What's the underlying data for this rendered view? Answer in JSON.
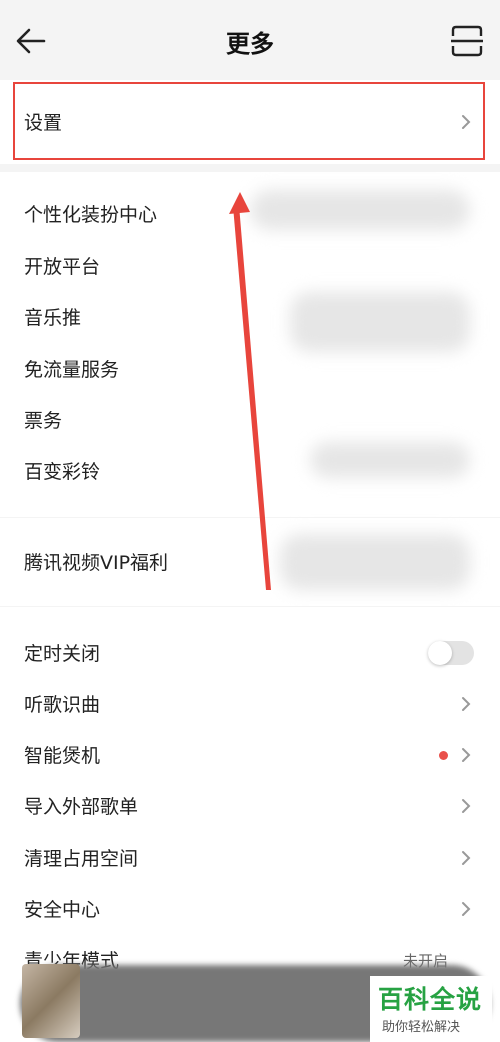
{
  "header": {
    "title": "更多",
    "back_icon": "arrow-left-icon",
    "scan_icon": "scan-icon"
  },
  "settings": {
    "label": "设置"
  },
  "group1": [
    {
      "label": "个性化装扮中心"
    },
    {
      "label": "开放平台"
    },
    {
      "label": "音乐推"
    },
    {
      "label": "免流量服务"
    },
    {
      "label": "票务"
    },
    {
      "label": "百变彩铃"
    }
  ],
  "group2": {
    "label": "腾讯视频VIP福利"
  },
  "group3": [
    {
      "label": "定时关闭",
      "control": "toggle",
      "toggle_on": false
    },
    {
      "label": "听歌识曲",
      "control": "chevron"
    },
    {
      "label": "智能煲机",
      "control": "dot-chevron"
    },
    {
      "label": "导入外部歌单",
      "control": "chevron"
    },
    {
      "label": "清理占用空间",
      "control": "chevron"
    },
    {
      "label": "安全中心",
      "control": "chevron"
    },
    {
      "label": "青少年模式",
      "status": "未开启"
    }
  ],
  "colors": {
    "highlight": "#e8453c",
    "arrow": "#e8453c",
    "dot": "#e9504b",
    "brand": "#27a243"
  },
  "watermark": {
    "title": "百科全说",
    "subtitle": "助你轻松解决"
  }
}
